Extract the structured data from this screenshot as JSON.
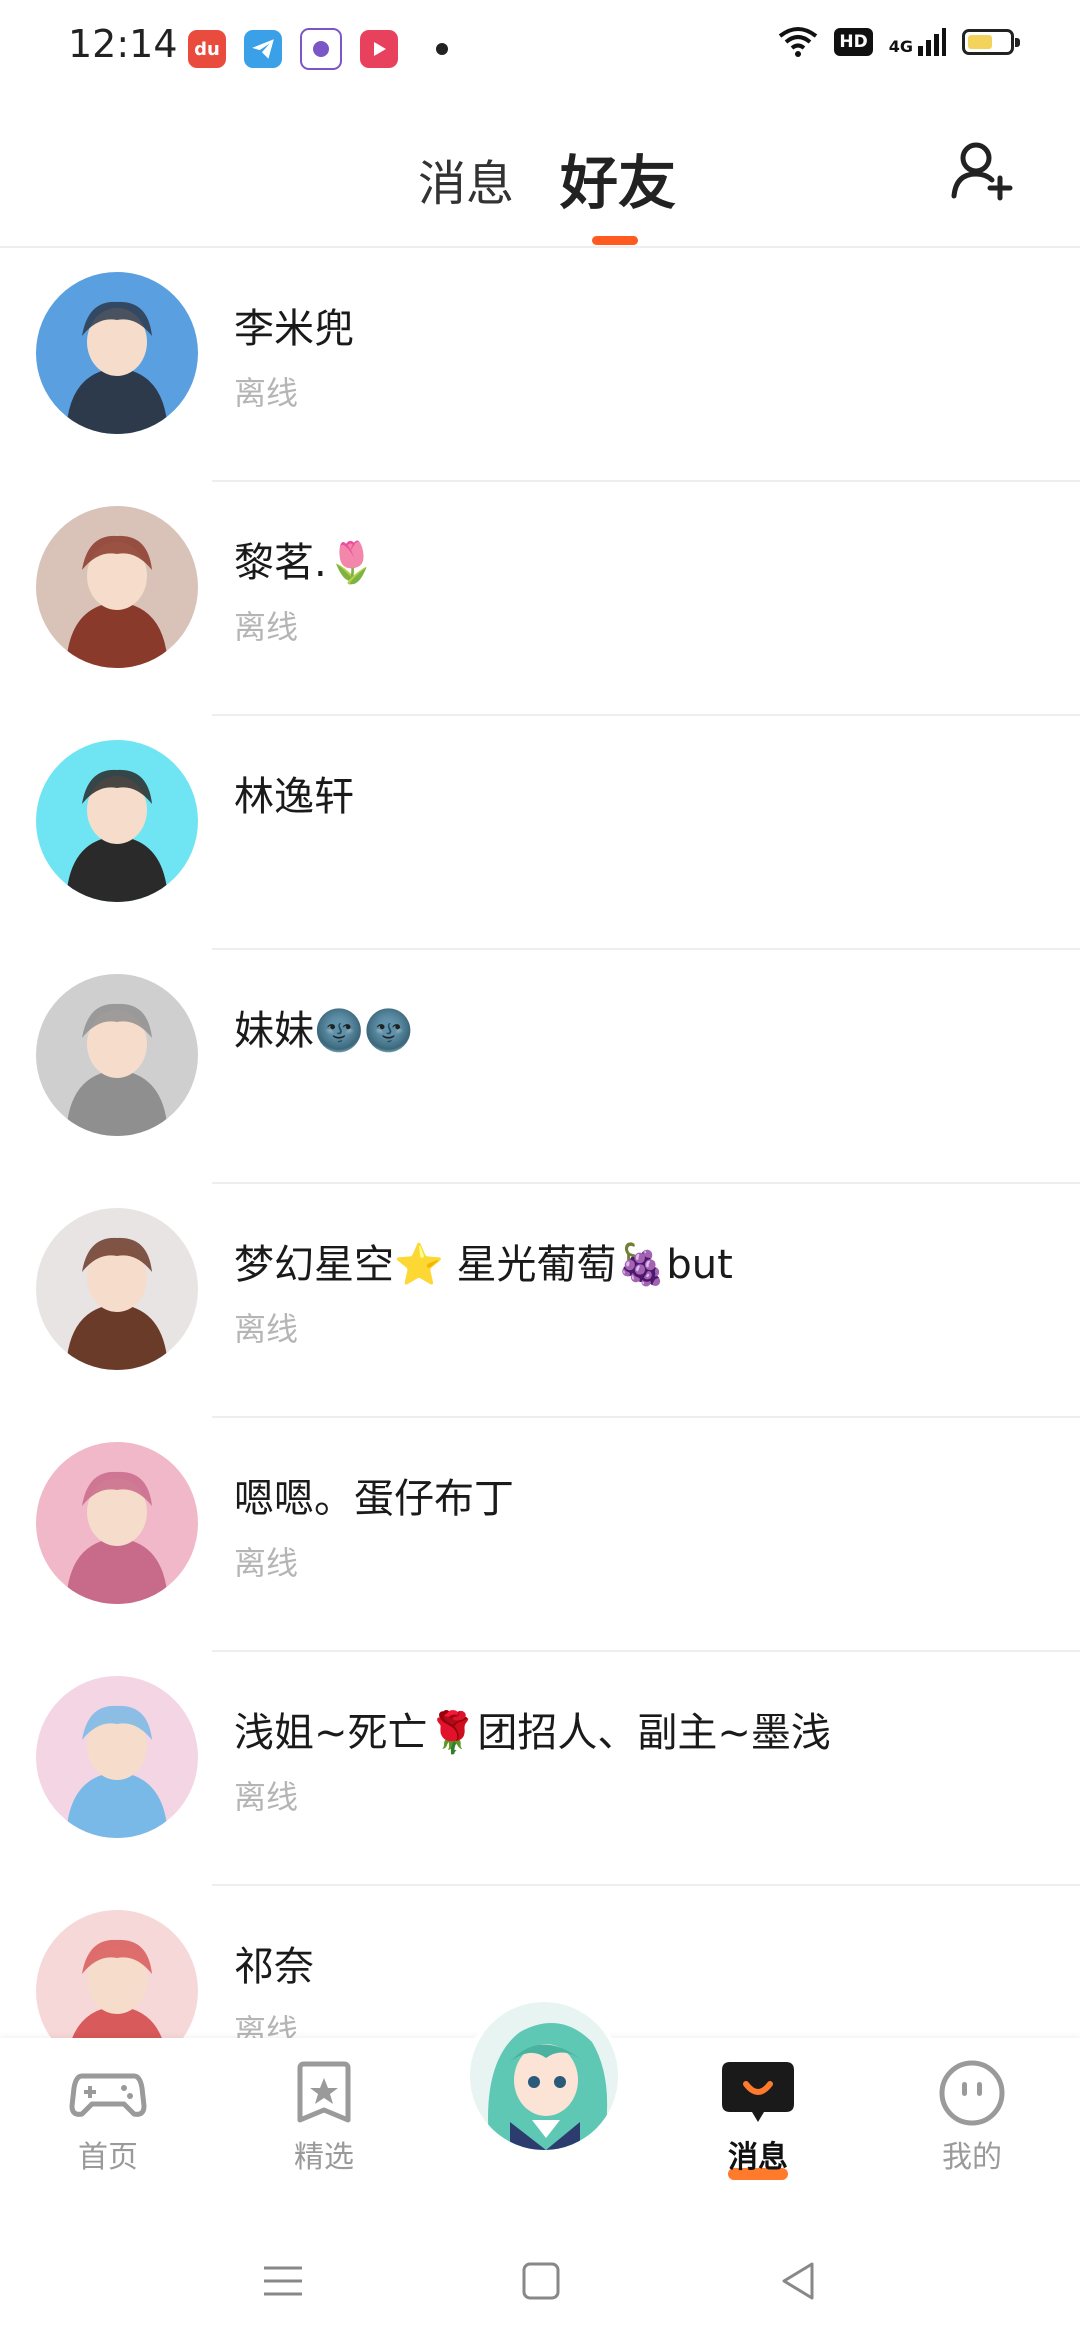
{
  "status_bar": {
    "time": "12:14",
    "hd": "HD",
    "network": "4G",
    "battery_level": 0.6
  },
  "header": {
    "tab_messages": "消息",
    "tab_friends": "好友",
    "active_tab": "好友"
  },
  "friends": [
    {
      "name": "李米兜",
      "status": "离线",
      "avatar_colors": [
        "#5aa0e0",
        "#2d3a4c"
      ]
    },
    {
      "name": "黎茗.🌷",
      "status": "离线",
      "avatar_colors": [
        "#d9c3b8",
        "#8a3a2a"
      ]
    },
    {
      "name": "林逸轩",
      "status": "",
      "avatar_colors": [
        "#6fe4f2",
        "#2a2a2a"
      ]
    },
    {
      "name": "妹妹🌚🌚",
      "status": "",
      "avatar_colors": [
        "#cfcfcf",
        "#8f8f8f"
      ]
    },
    {
      "name": "梦幻星空⭐ 星光葡萄🍇but",
      "status": "离线",
      "avatar_colors": [
        "#e9e4e4",
        "#6b3b2a"
      ]
    },
    {
      "name": "嗯嗯。蛋仔布丁",
      "status": "离线",
      "avatar_colors": [
        "#f0b8c8",
        "#c86a8a"
      ]
    },
    {
      "name": "浅姐~死亡🌹团招人、副主~墨浅",
      "status": "离线",
      "avatar_colors": [
        "#f3d5e4",
        "#79b9e8"
      ]
    },
    {
      "name": "祁奈",
      "status": "离线",
      "avatar_colors": [
        "#f7d8d8",
        "#d85a5a"
      ]
    }
  ],
  "bottom_nav": {
    "home": "首页",
    "featured": "精选",
    "messages": "消息",
    "mine": "我的",
    "active": "消息",
    "accent_color": "#ff7a2a"
  },
  "colors": {
    "tab_indicator": "#ff5a1f",
    "status_gray": "#b5b5b5"
  }
}
